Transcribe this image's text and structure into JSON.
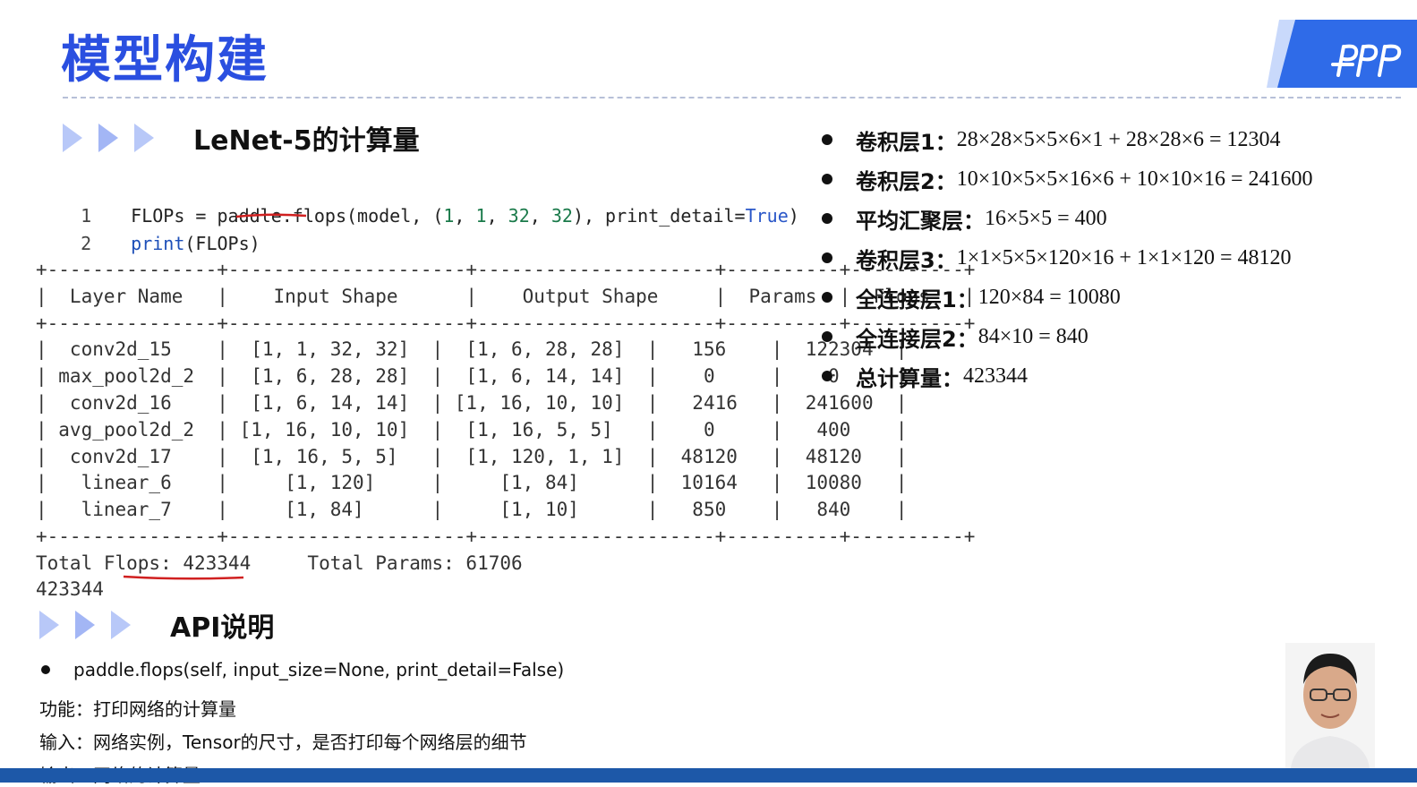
{
  "slide": {
    "title": "模型构建",
    "section1": {
      "title": "LeNet-5的计算量"
    },
    "code": [
      {
        "line_no": "1",
        "parts": [
          {
            "text": "FLOPs = paddle.flops(model, (",
            "cls": ""
          },
          {
            "text": "1",
            "cls": "num-green"
          },
          {
            "text": ", ",
            "cls": ""
          },
          {
            "text": "1",
            "cls": "num-green"
          },
          {
            "text": ", ",
            "cls": ""
          },
          {
            "text": "32",
            "cls": "num-green"
          },
          {
            "text": ", ",
            "cls": ""
          },
          {
            "text": "32",
            "cls": "num-green"
          },
          {
            "text": "), print_detail=",
            "cls": ""
          },
          {
            "text": "True",
            "cls": "kw-true"
          },
          {
            "text": ")",
            "cls": ""
          }
        ]
      },
      {
        "line_no": "2",
        "parts": [
          {
            "text": "print",
            "cls": "kw-blue"
          },
          {
            "text": "(FLOPs)",
            "cls": ""
          }
        ]
      }
    ],
    "table": {
      "border": "+---------------+---------------------+---------------------+----------+----------+",
      "header": "|  Layer Name   |    Input Shape      |    Output Shape     |  Params  |  Flops   |",
      "rows": [
        "|  conv2d_15    |  [1, 1, 32, 32]  |  [1, 6, 28, 28]  |   156    |  122304  |",
        "| max_pool2d_2  |  [1, 6, 28, 28]  |  [1, 6, 14, 14]  |    0     |    0     |",
        "|  conv2d_16    |  [1, 6, 14, 14]  | [1, 16, 10, 10]  |   2416   |  241600  |",
        "| avg_pool2d_2  | [1, 16, 10, 10]  |  [1, 16, 5, 5]   |    0     |   400    |",
        "|  conv2d_17    |  [1, 16, 5, 5]   |  [1, 120, 1, 1]  |  48120   |  48120   |",
        "|   linear_6    |     [1, 120]     |     [1, 84]      |  10164   |  10080   |",
        "|   linear_7    |     [1, 84]      |     [1, 10]      |   850    |   840    |"
      ],
      "columns": [
        "Layer Name",
        "Input Shape",
        "Output Shape",
        "Params",
        "Flops"
      ],
      "data": [
        [
          "conv2d_15",
          "[1, 1, 32, 32]",
          "[1, 6, 28, 28]",
          "156",
          "122304"
        ],
        [
          "max_pool2d_2",
          "[1, 6, 28, 28]",
          "[1, 6, 14, 14]",
          "0",
          "0"
        ],
        [
          "conv2d_16",
          "[1, 6, 14, 14]",
          "[1, 16, 10, 10]",
          "2416",
          "241600"
        ],
        [
          "avg_pool2d_2",
          "[1, 16, 10, 10]",
          "[1, 16, 5, 5]",
          "0",
          "400"
        ],
        [
          "conv2d_17",
          "[1, 16, 5, 5]",
          "[1, 120, 1, 1]",
          "48120",
          "48120"
        ],
        [
          "linear_6",
          "[1, 120]",
          "[1, 84]",
          "10164",
          "10080"
        ],
        [
          "linear_7",
          "[1, 84]",
          "[1, 10]",
          "850",
          "840"
        ]
      ]
    },
    "totals": {
      "line1": "Total Flops: 423344     Total Params: 61706",
      "line2": "423344"
    },
    "bullets": [
      {
        "label": "卷积层1：",
        "value": "28×28×5×5×6×1 + 28×28×6 = 12304"
      },
      {
        "label": "卷积层2：",
        "value": "10×10×5×5×16×6 + 10×10×16 = 241600"
      },
      {
        "label": "平均汇聚层：",
        "value": " 16×5×5 = 400"
      },
      {
        "label": "卷积层3：",
        "value": "1×1×5×5×120×16 + 1×1×120 = 48120"
      },
      {
        "label": "全连接层1：",
        "value": "120×84 = 10080"
      },
      {
        "label": "全连接层2：",
        "value": "84×10 = 840"
      },
      {
        "label": "总计算量：",
        "value": "423344"
      }
    ],
    "section2": {
      "title": "API说明"
    },
    "api": {
      "signature": "paddle.flops(self, input_size=None, print_detail=False)",
      "function": "功能：打印网络的计算量",
      "input": "输入：网络实例，Tensor的尺寸，是否打印每个网络层的细节",
      "output": "输出：网络的计算量"
    },
    "colors": {
      "title": "#2a4fe0",
      "accent": "#2f6be8",
      "underline": "#d02020",
      "bar": "#1d58a8"
    },
    "icons": [
      "chevron-right-icon",
      "logo-icon",
      "presenter-avatar"
    ]
  }
}
